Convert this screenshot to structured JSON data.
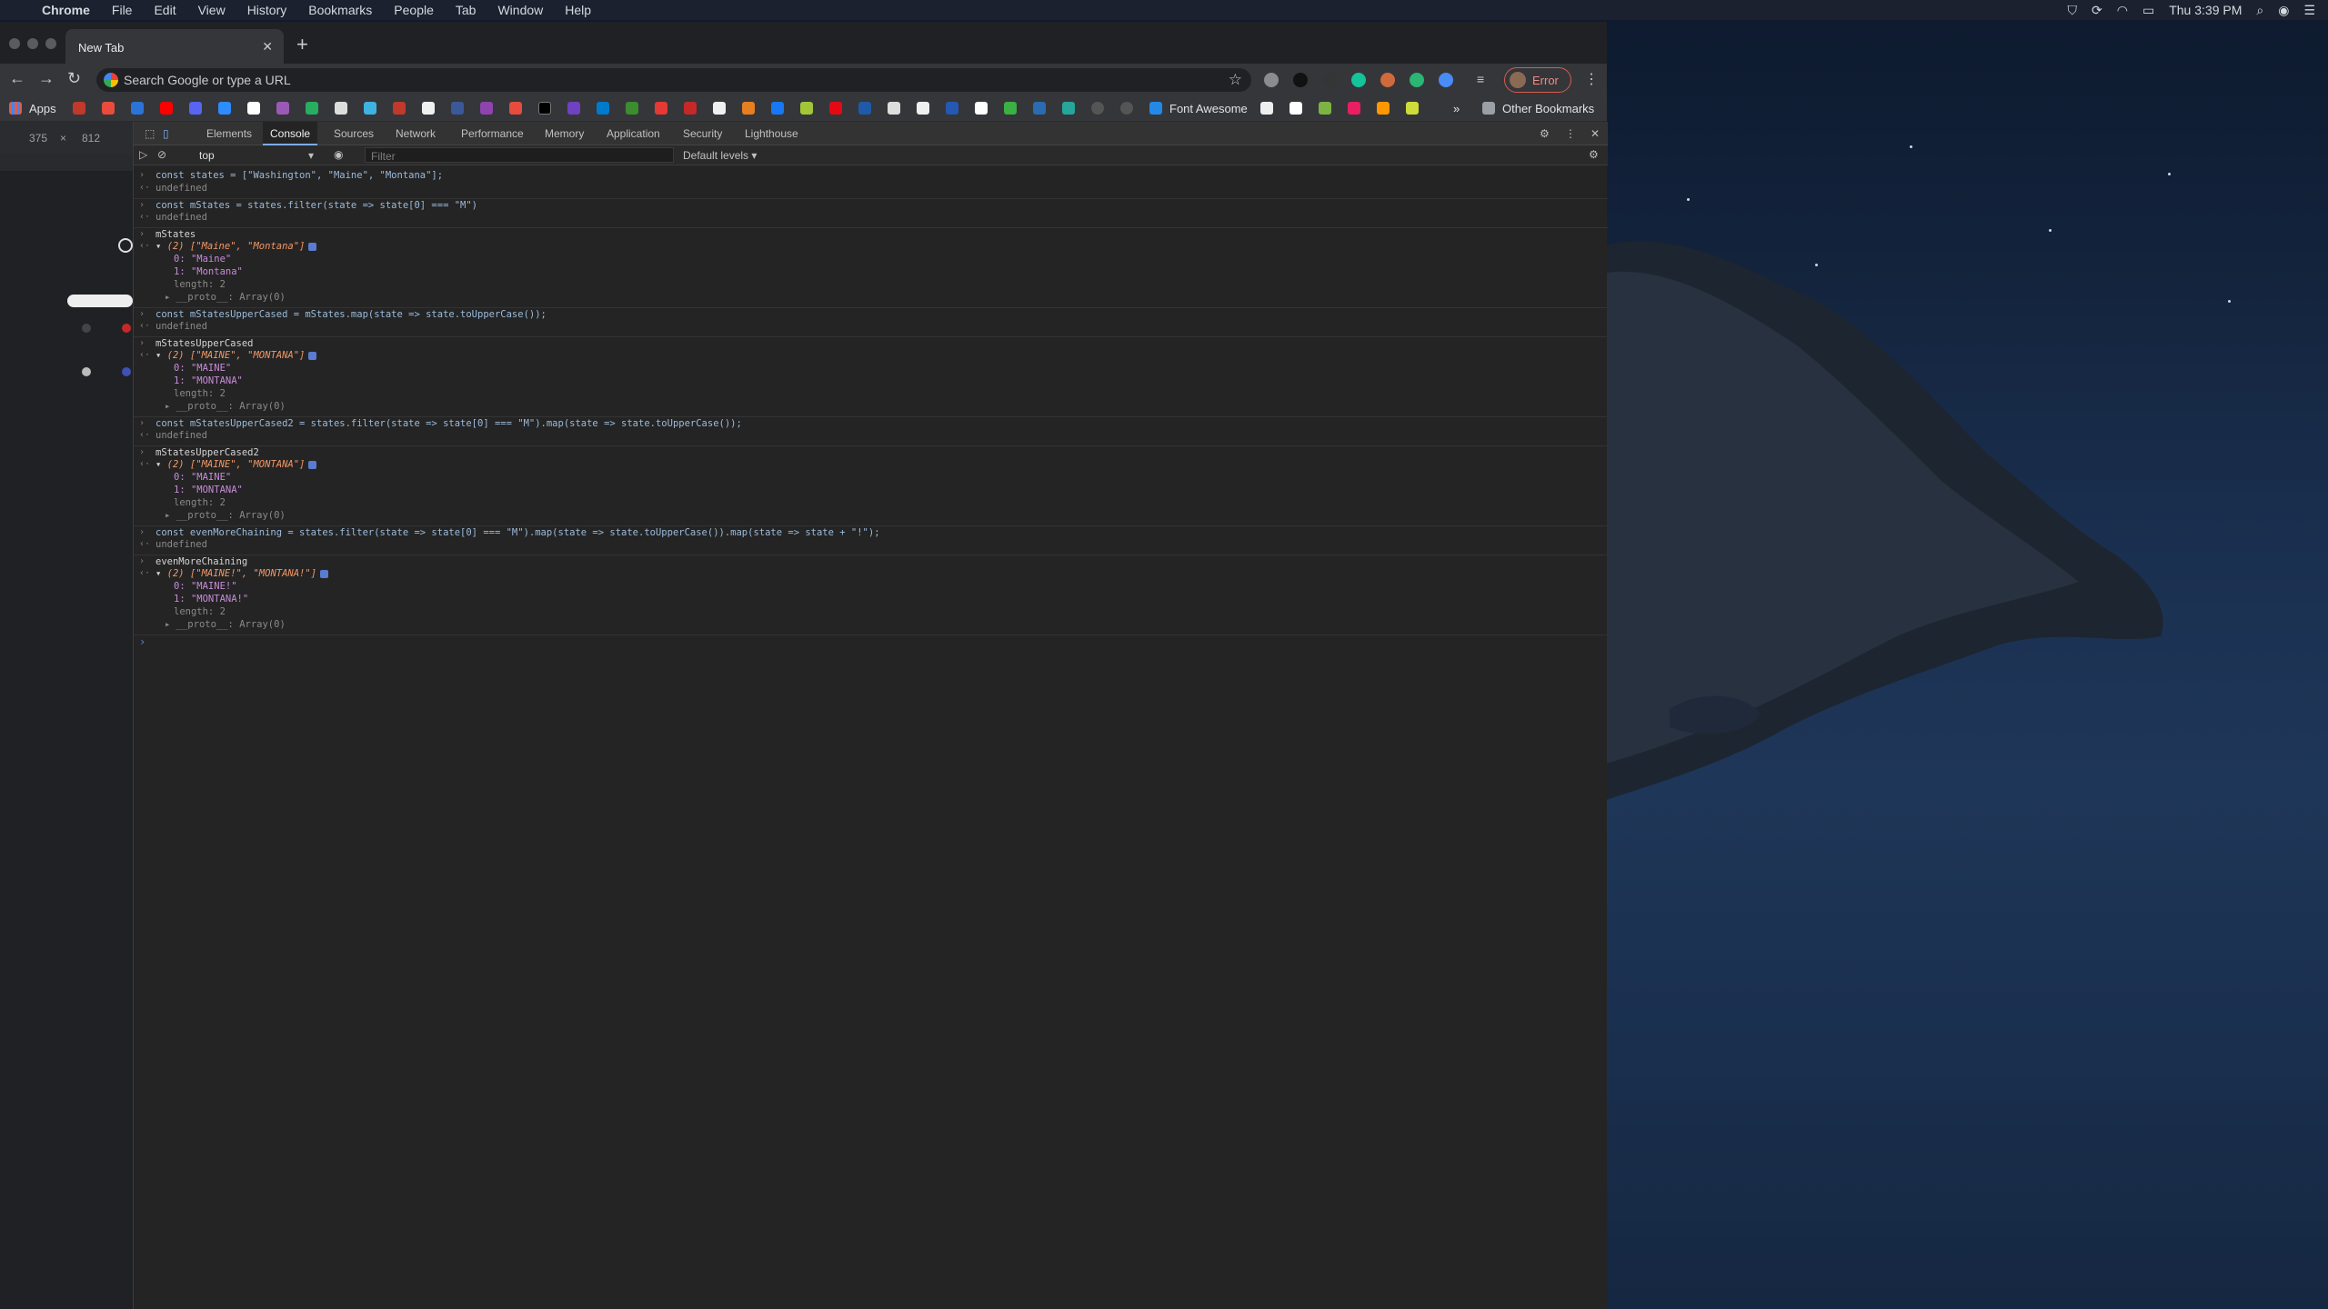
{
  "menubar": {
    "items": [
      "Chrome",
      "File",
      "Edit",
      "View",
      "History",
      "Bookmarks",
      "People",
      "Tab",
      "Window",
      "Help"
    ],
    "clock": "Thu 3:39 PM"
  },
  "browser": {
    "tab_title": "New Tab",
    "omnibox_placeholder": "Search Google or type a URL",
    "profile_button": "Error",
    "bookmarks": {
      "apps_label": "Apps",
      "font_awesome": "Font Awesome",
      "other": "Other Bookmarks"
    }
  },
  "device_toolbar": {
    "width": "375",
    "times": "×",
    "height": "812"
  },
  "devtools": {
    "tabs": [
      "Elements",
      "Console",
      "Sources",
      "Network",
      "Performance",
      "Memory",
      "Application",
      "Security",
      "Lighthouse"
    ],
    "active_tab": "Console",
    "context": "top",
    "filter_placeholder": "Filter",
    "levels": "Default levels ▾"
  },
  "console": {
    "undefined": "undefined",
    "line1": "const states = [\"Washington\", \"Maine\", \"Montana\"];",
    "line2": "const mStates = states.filter(state => state[0] === \"M\")",
    "line3": "mStates",
    "arr1_head": "(2) [\"Maine\", \"Montana\"]",
    "arr1_0": "0: \"Maine\"",
    "arr1_1": "1: \"Montana\"",
    "length": "length: 2",
    "proto": "__proto__: Array(0)",
    "line4": "const mStatesUpperCased = mStates.map(state => state.toUpperCase());",
    "line5": "mStatesUpperCased",
    "arr2_head": "(2) [\"MAINE\", \"MONTANA\"]",
    "arr2_0": "0: \"MAINE\"",
    "arr2_1": "1: \"MONTANA\"",
    "line6": "const mStatesUpperCased2 = states.filter(state => state[0] === \"M\").map(state => state.toUpperCase());",
    "line7": "mStatesUpperCased2",
    "line8": "const evenMoreChaining = states.filter(state => state[0] === \"M\").map(state => state.toUpperCase()).map(state => state + \"!\");",
    "line9": "evenMoreChaining",
    "arr4_head": "(2) [\"MAINE!\", \"MONTANA!\"]",
    "arr4_0": "0: \"MAINE!\"",
    "arr4_1": "1: \"MONTANA!\""
  }
}
